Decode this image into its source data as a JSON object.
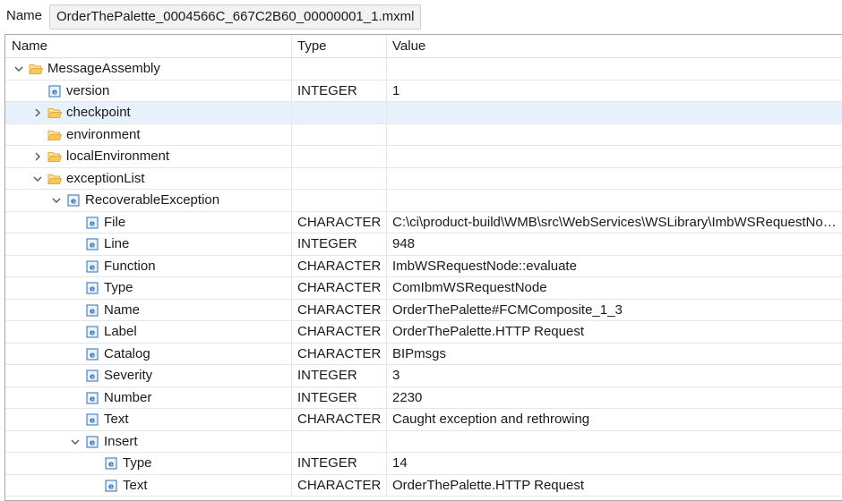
{
  "name_label": "Name",
  "name_value": "OrderThePalette_0004566C_667C2B60_00000001_1.mxml",
  "columns": {
    "name": "Name",
    "type": "Type",
    "value": "Value"
  },
  "rows": [
    {
      "depth": 0,
      "twisty": "expanded",
      "kind": "folder",
      "name": "MessageAssembly",
      "type": "",
      "value": ""
    },
    {
      "depth": 1,
      "twisty": "none",
      "kind": "element",
      "name": "version",
      "type": "INTEGER",
      "value": "1"
    },
    {
      "depth": 1,
      "twisty": "collapsed",
      "kind": "folder",
      "name": "checkpoint",
      "type": "",
      "value": "",
      "selected": true
    },
    {
      "depth": 1,
      "twisty": "none",
      "kind": "folder",
      "name": "environment",
      "type": "",
      "value": ""
    },
    {
      "depth": 1,
      "twisty": "collapsed",
      "kind": "folder",
      "name": "localEnvironment",
      "type": "",
      "value": ""
    },
    {
      "depth": 1,
      "twisty": "expanded",
      "kind": "folder",
      "name": "exceptionList",
      "type": "",
      "value": ""
    },
    {
      "depth": 2,
      "twisty": "expanded",
      "kind": "element",
      "name": "RecoverableException",
      "type": "",
      "value": ""
    },
    {
      "depth": 3,
      "twisty": "none",
      "kind": "element",
      "name": "File",
      "type": "CHARACTER",
      "value": "C:\\ci\\product-build\\WMB\\src\\WebServices\\WSLibrary\\ImbWSRequestNode.cpp"
    },
    {
      "depth": 3,
      "twisty": "none",
      "kind": "element",
      "name": "Line",
      "type": "INTEGER",
      "value": "948"
    },
    {
      "depth": 3,
      "twisty": "none",
      "kind": "element",
      "name": "Function",
      "type": "CHARACTER",
      "value": "ImbWSRequestNode::evaluate"
    },
    {
      "depth": 3,
      "twisty": "none",
      "kind": "element",
      "name": "Type",
      "type": "CHARACTER",
      "value": "ComIbmWSRequestNode"
    },
    {
      "depth": 3,
      "twisty": "none",
      "kind": "element",
      "name": "Name",
      "type": "CHARACTER",
      "value": "OrderThePalette#FCMComposite_1_3"
    },
    {
      "depth": 3,
      "twisty": "none",
      "kind": "element",
      "name": "Label",
      "type": "CHARACTER",
      "value": "OrderThePalette.HTTP Request"
    },
    {
      "depth": 3,
      "twisty": "none",
      "kind": "element",
      "name": "Catalog",
      "type": "CHARACTER",
      "value": "BIPmsgs"
    },
    {
      "depth": 3,
      "twisty": "none",
      "kind": "element",
      "name": "Severity",
      "type": "INTEGER",
      "value": "3"
    },
    {
      "depth": 3,
      "twisty": "none",
      "kind": "element",
      "name": "Number",
      "type": "INTEGER",
      "value": "2230"
    },
    {
      "depth": 3,
      "twisty": "none",
      "kind": "element",
      "name": "Text",
      "type": "CHARACTER",
      "value": "Caught exception and rethrowing"
    },
    {
      "depth": 3,
      "twisty": "expanded",
      "kind": "element",
      "name": "Insert",
      "type": "",
      "value": ""
    },
    {
      "depth": 4,
      "twisty": "none",
      "kind": "element",
      "name": "Type",
      "type": "INTEGER",
      "value": "14"
    },
    {
      "depth": 4,
      "twisty": "none",
      "kind": "element",
      "name": "Text",
      "type": "CHARACTER",
      "value": "OrderThePalette.HTTP Request"
    }
  ],
  "colors": {
    "selection": "#e6f1fb",
    "folder": "#e7a93a",
    "element_icon": "#2f6fb4"
  }
}
